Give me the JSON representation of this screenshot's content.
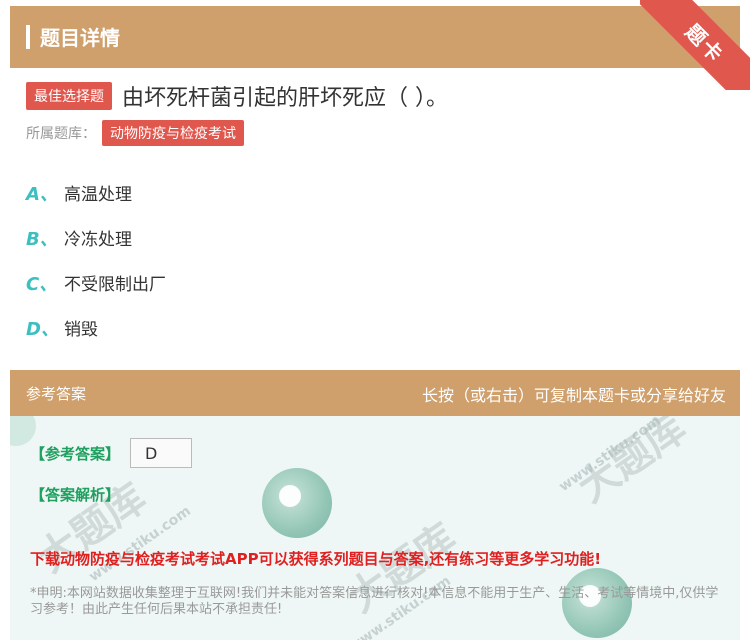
{
  "header": {
    "title": "题目详情"
  },
  "ribbon": {
    "label": "题卡"
  },
  "question": {
    "tag": "最佳选择题",
    "text": "由坏死杆菌引起的肝坏死应（ ）。"
  },
  "bank": {
    "label": "所属题库：",
    "value": "动物防疫与检疫考试"
  },
  "options": [
    {
      "letter": "A、",
      "text": "高温处理"
    },
    {
      "letter": "B、",
      "text": "冷冻处理"
    },
    {
      "letter": "C、",
      "text": "不受限制出厂"
    },
    {
      "letter": "D、",
      "text": "销毁"
    }
  ],
  "answer_section": {
    "title": "参考答案",
    "hint": "长按（或右击）可复制本题卡或分享给好友",
    "ref_label": "【参考答案】",
    "ref_value": "D",
    "analysis_label": "【答案解析】",
    "promo": "下载动物防疫与检疫考试考试APP可以获得系列题目与答案,还有练习等更多学习功能!",
    "disclaimer": "*申明:本网站数据收集整理于互联网!我们并未能对答案信息进行核对!本信息不能用于生产、生活、考试等情境中,仅供学习参考！由此产生任何后果本站不承担责任!"
  },
  "watermark": {
    "text": "大题库",
    "url": "www.stiku.com"
  },
  "colors": {
    "header_bg": "#cf9f6c",
    "tag_red": "#e0574e",
    "option_letter": "#3dbfc0",
    "answer_green": "#20a060",
    "promo_red": "#e02020",
    "answer_body_bg": "#eef7f5"
  }
}
